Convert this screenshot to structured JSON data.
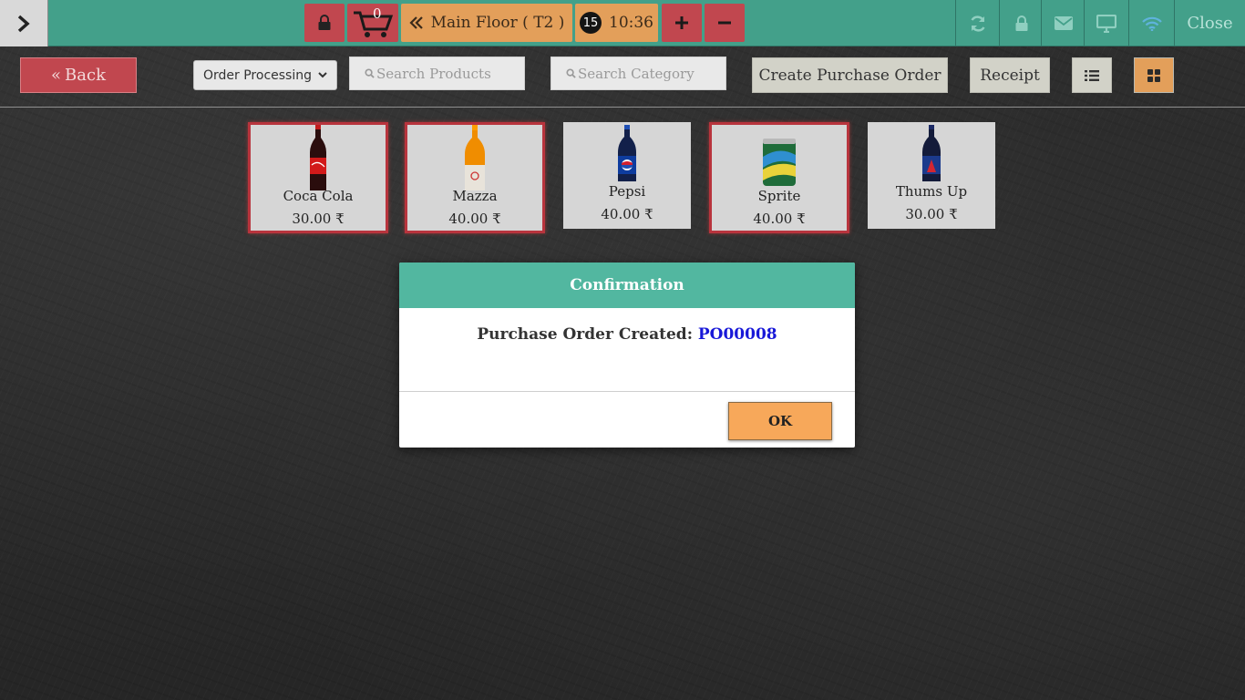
{
  "topbar": {
    "menu_toggle_icon": "chevron-right-icon",
    "lock_icon": "lock-icon",
    "cart": {
      "icon": "cart-icon",
      "count": "0"
    },
    "floor": {
      "label": "Main Floor ( T2 )",
      "icon": "double-chevron-left-icon"
    },
    "token": "15",
    "time": "10:36",
    "plus_icon": "plus-icon",
    "minus_icon": "minus-icon",
    "right_icons": [
      "refresh-icon",
      "lock-icon",
      "envelope-icon",
      "monitor-icon",
      "wifi-icon"
    ],
    "close_label": "Close"
  },
  "toolbar": {
    "back_label": "Back",
    "status_select": {
      "selected": "Order Processing"
    },
    "search_products_placeholder": "Search Products",
    "search_category_placeholder": "Search Category",
    "create_po_label": "Create Purchase Order",
    "receipt_label": "Receipt",
    "list_view_icon": "list-icon",
    "grid_view_icon": "grid-icon"
  },
  "products": [
    {
      "name": "Coca Cola",
      "price": "30.00 ₹",
      "selected": true
    },
    {
      "name": "Mazza",
      "price": "40.00 ₹",
      "selected": true
    },
    {
      "name": "Pepsi",
      "price": "40.00 ₹",
      "selected": false
    },
    {
      "name": "Sprite",
      "price": "40.00 ₹",
      "selected": true
    },
    {
      "name": "Thums Up",
      "price": "30.00 ₹",
      "selected": false
    }
  ],
  "modal": {
    "title": "Confirmation",
    "message": "Purchase Order Created:",
    "po_number": "PO00008",
    "ok_label": "OK"
  },
  "colors": {
    "topbar": "#43a08a",
    "red": "#c1474f",
    "orange": "#e39f5a",
    "modal_header": "#52b7a0",
    "ok_button": "#f7a85a",
    "po_link": "#1818d8"
  }
}
